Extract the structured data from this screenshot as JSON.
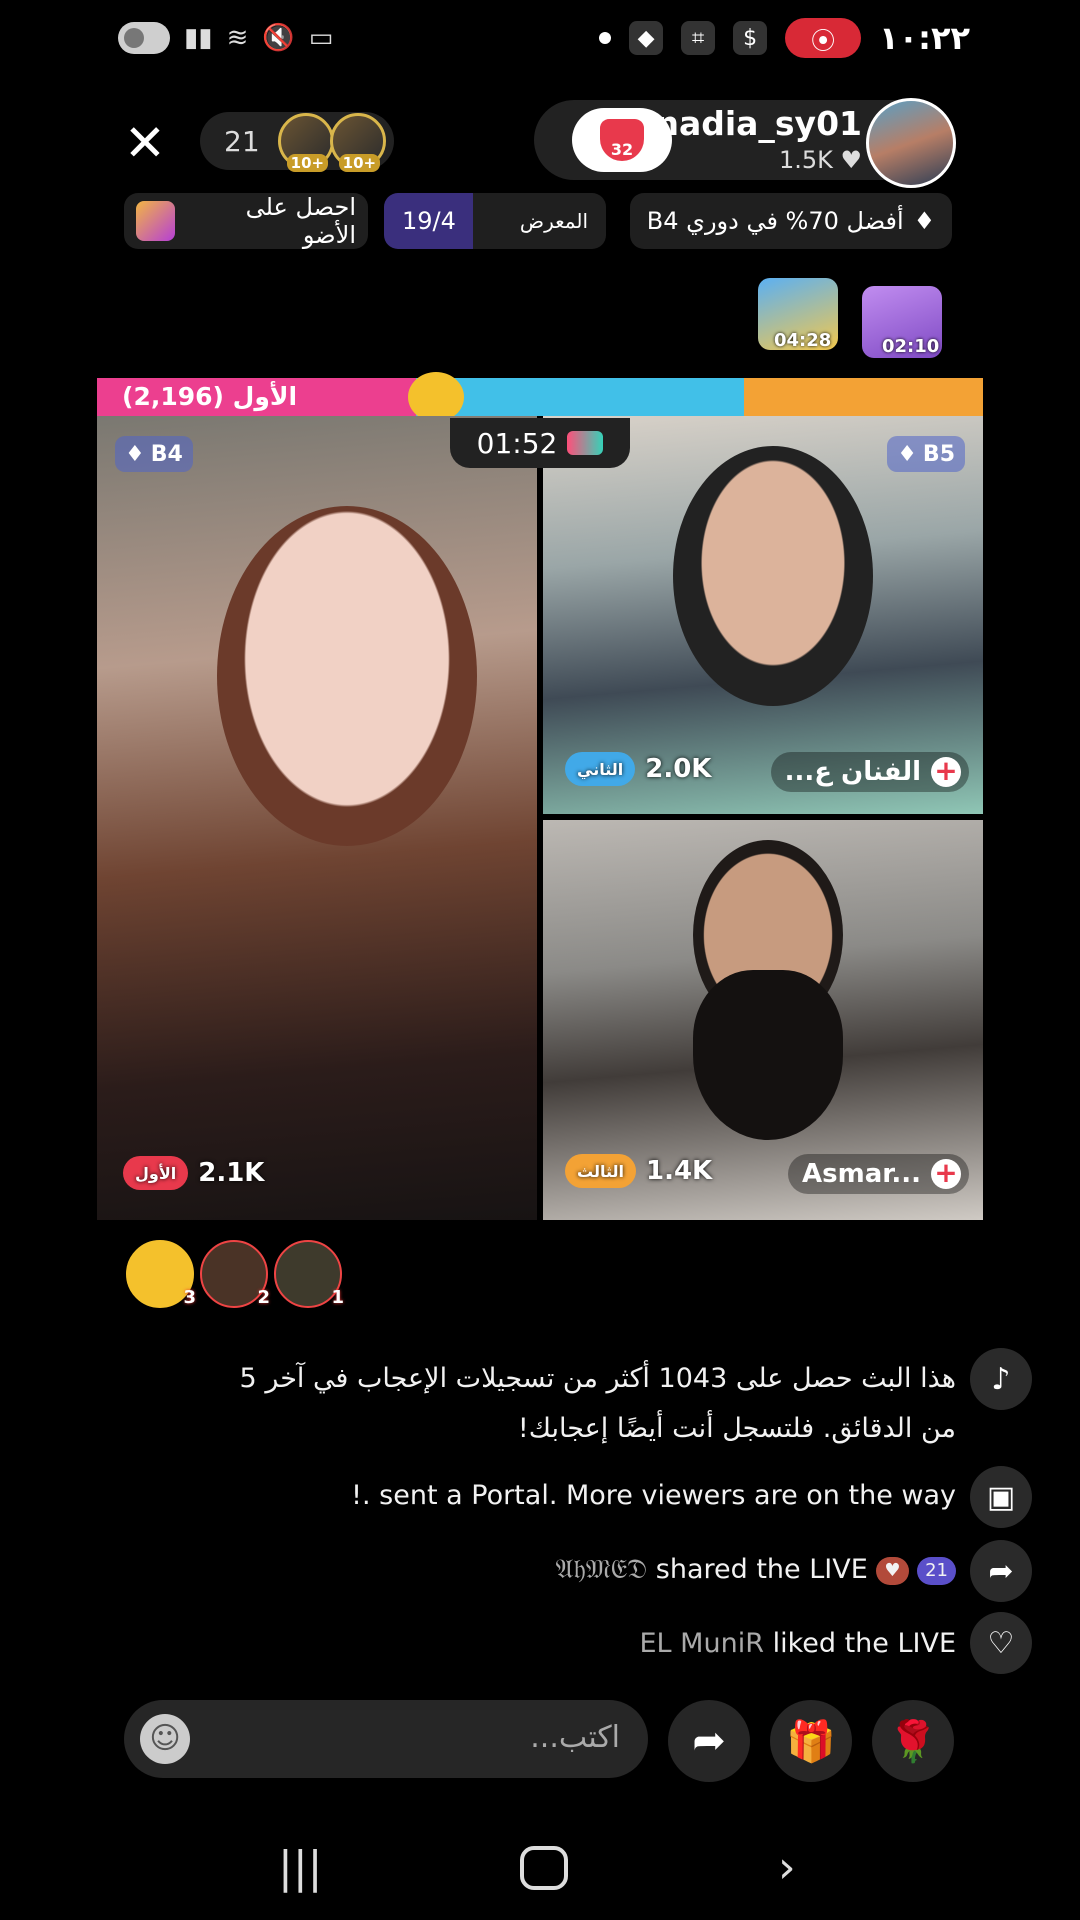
{
  "status_bar": {
    "clock": "١٠:٢٢"
  },
  "header": {
    "close_glyph": "✕",
    "viewer_count": "21",
    "mini_badges": [
      "10+",
      "10+"
    ],
    "host_name": "nadia_sy01",
    "host_likes": "1.5K",
    "heart_count": "32"
  },
  "chips": {
    "rank": "أفضل 70% في دوري B4",
    "gallery_label": "المعرض",
    "gallery_count": "19/4",
    "get_label": "احصل على الأضو"
  },
  "treasure": {
    "timer_1": "04:28",
    "timer_2": "02:10"
  },
  "battle": {
    "leader_label": "الأول (2,196)",
    "timer": "01:52",
    "host": {
      "badge": "B4",
      "score": "2.1K",
      "place": "الأول"
    },
    "guest_top": {
      "badge": "B5",
      "score": "2.0K",
      "place": "الثاني",
      "name": "الفنان ع..."
    },
    "guest_bottom": {
      "score": "1.4K",
      "place": "الثالث",
      "name": "Asmar..."
    }
  },
  "gifters": [
    "3",
    "2",
    "1"
  ],
  "comments": [
    {
      "icon": "tiktok-icon",
      "text": "هذا البث حصل على 1043 أكثر من تسجيلات الإعجاب في آخر 5 من الدقائق. فلتسجل أنت أيضًا إعجابك!"
    },
    {
      "icon": "portal-icon",
      "text": "!. sent a Portal. More viewers are on the way"
    },
    {
      "icon": "share-icon",
      "user": "𝔄𝔥𝔐𝔈𝔇",
      "text": "shared the LIVE",
      "tag_count": "21"
    },
    {
      "icon": "heart-icon",
      "user": "EL  MuniR",
      "text": "liked the LIVE"
    }
  ],
  "input": {
    "placeholder": "اكتب..."
  },
  "colors": {
    "pink": "#ec3f8f",
    "cyan": "#41c0e8",
    "orange": "#f3a235",
    "red": "#e8394c"
  }
}
